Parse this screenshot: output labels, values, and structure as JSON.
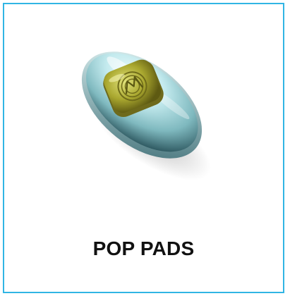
{
  "product": {
    "name": "POP PADS",
    "image_icon": "silicone-nose-pad-icon"
  },
  "colors": {
    "border": "#31b5e4",
    "pad_body": "#b7e5ea",
    "pad_plate": "#b3b33a",
    "text": "#111111"
  }
}
